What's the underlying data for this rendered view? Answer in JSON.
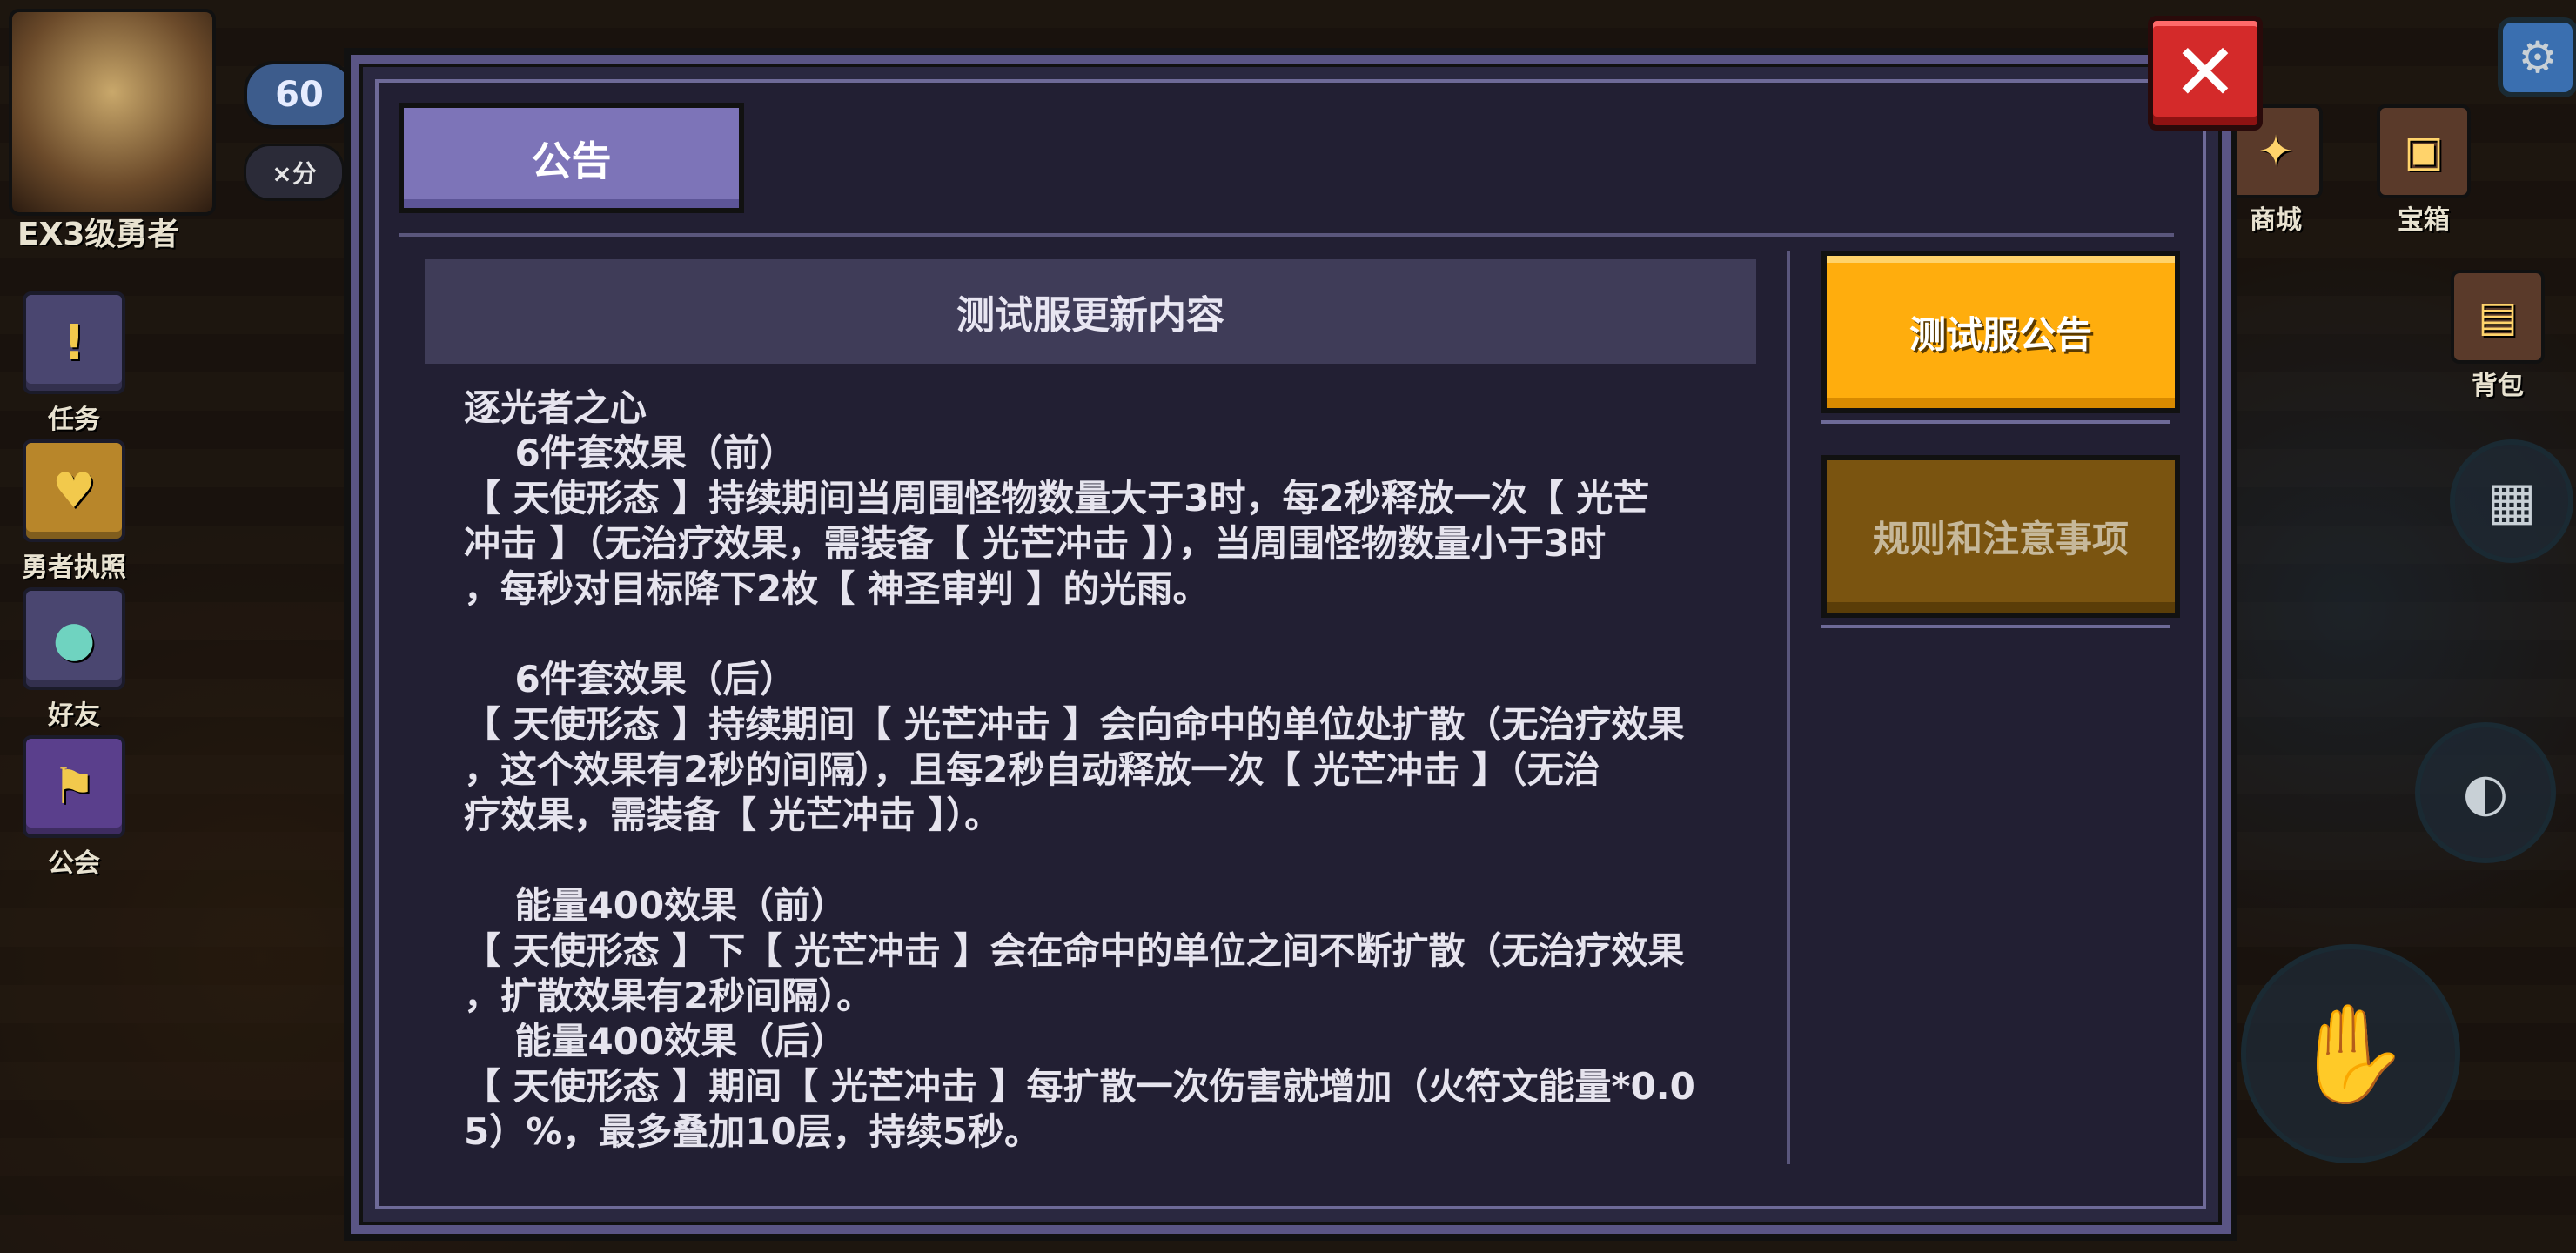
{
  "hud": {
    "avatar_label": "EX3级勇者",
    "level": "60",
    "score": "×分",
    "left_items": [
      {
        "label": "任务",
        "icon": "exclamation-icon"
      },
      {
        "label": "勇者执照",
        "icon": "badge-icon"
      },
      {
        "label": "好友",
        "icon": "friend-icon"
      },
      {
        "label": "公会",
        "icon": "guild-banner-icon"
      }
    ],
    "right_items": [
      {
        "label": "商城",
        "icon": "shop-icon"
      },
      {
        "label": "宝箱",
        "icon": "chest-icon"
      },
      {
        "label": "背包",
        "icon": "backpack-icon"
      }
    ]
  },
  "modal": {
    "title": "公告",
    "header": "测试服更新内容",
    "body": "逐光者之心\n    6件套效果（前）\n【 天使形态 】持续期间当周围怪物数量大于3时，每2秒释放一次【 光芒\n冲击 】（无治疗效果，需装备【 光芒冲击 】），当周围怪物数量小于3时\n，每秒对目标降下2枚【 神圣审判 】的光雨。\n\n    6件套效果（后）\n【 天使形态 】持续期间【 光芒冲击 】会向命中的单位处扩散（无治疗效果\n，这个效果有2秒的间隔），且每2秒自动释放一次【 光芒冲击 】（无治\n疗效果，需装备【 光芒冲击 】）。\n\n    能量400效果（前）\n【 天使形态 】下【 光芒冲击 】会在命中的单位之间不断扩散（无治疗效果\n，扩散效果有2秒间隔）。\n    能量400效果（后）\n【 天使形态 】期间【 光芒冲击 】每扩散一次伤害就增加（火符文能量*0.0\n5）%，最多叠加10层，持续5秒。",
    "side_buttons": {
      "test_notice": "测试服公告",
      "rules": "规则和注意事项"
    },
    "close_label": "✕"
  },
  "colors": {
    "active_button": "#ffad0d",
    "inactive_button": "#7a5410",
    "tab": "#7d74b8",
    "close": "#d42a2a"
  }
}
